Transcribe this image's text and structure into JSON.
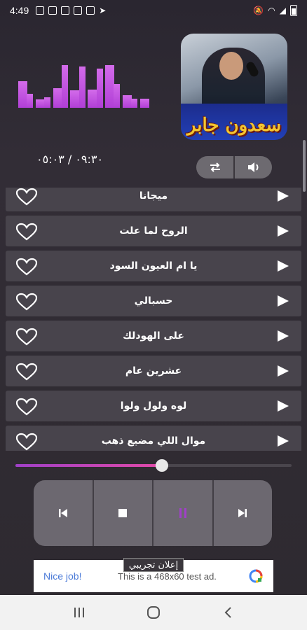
{
  "status_bar": {
    "time": "4:49",
    "signal_text": "🔕 ⚡ ▲◢"
  },
  "equalizer": {
    "levels": [
      0.58,
      0.3,
      0.18,
      0.22,
      0.42,
      0.92,
      0.38,
      0.9,
      0.4,
      0.85,
      0.92,
      0.52,
      0.28,
      0.2,
      0.2
    ]
  },
  "album": {
    "artist_name": "سعدون جابر"
  },
  "player": {
    "time_display": "٠٩:٣٠ / ٠٥:٠٣",
    "progress": 0.53
  },
  "songs": [
    {
      "title": "ميجانا"
    },
    {
      "title": "الروح لما علت"
    },
    {
      "title": "يا ام العيون السود"
    },
    {
      "title": "حسبالي"
    },
    {
      "title": "على الهودلك"
    },
    {
      "title": "عشرين عام"
    },
    {
      "title": "لوه ولول ولوا"
    },
    {
      "title": "موال اللي مضيع ذهب"
    }
  ],
  "ad": {
    "label": "إعلان تجريبي",
    "nice": "Nice job!",
    "text": "This is a 468x60 test ad."
  },
  "colors": {
    "accent": "#b13fd6",
    "pause_active": "#a040c8"
  }
}
